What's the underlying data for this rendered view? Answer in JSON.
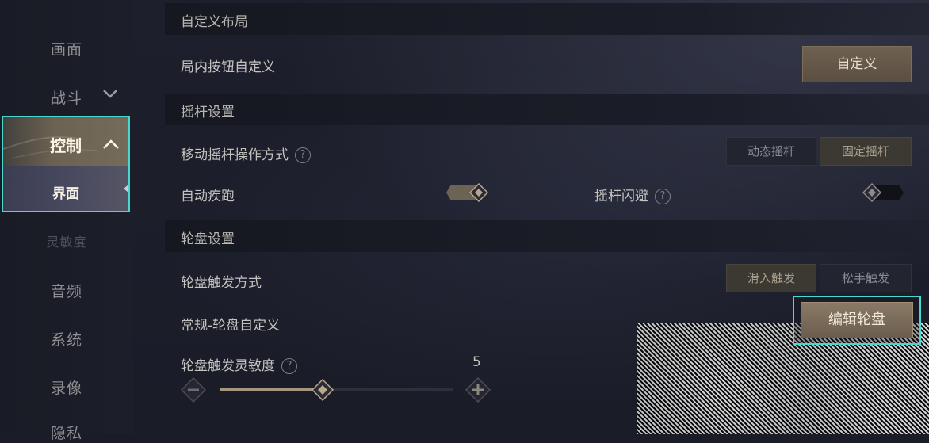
{
  "sidebar": {
    "items": [
      {
        "label": "画面"
      },
      {
        "label": "战斗"
      },
      {
        "label": "控制"
      },
      {
        "label": "界面"
      },
      {
        "label": "灵敏度"
      },
      {
        "label": "音频"
      },
      {
        "label": "系统"
      },
      {
        "label": "录像"
      },
      {
        "label": "隐私"
      }
    ]
  },
  "sections": {
    "custom_layout": {
      "title": "自定义布局",
      "in_game_buttons_label": "局内按钮自定义",
      "customize_button": "自定义"
    },
    "joystick": {
      "title": "摇杆设置",
      "mode_label": "移动摇杆操作方式",
      "mode_options": [
        "动态摇杆",
        "固定摇杆"
      ],
      "selected_mode": "固定摇杆",
      "auto_sprint_label": "自动疾跑",
      "auto_sprint_on": true,
      "dodge_label": "摇杆闪避",
      "dodge_on": false
    },
    "wheel": {
      "title": "轮盘设置",
      "trigger_label": "轮盘触发方式",
      "trigger_options": [
        "滑入触发",
        "松手触发"
      ],
      "selected_trigger": "滑入触发",
      "custom_label": "常规-轮盘自定义",
      "edit_button": "编辑轮盘",
      "sensitivity_label": "轮盘触发灵敏度",
      "sensitivity_value": "5",
      "sensitivity_fraction": 0.44
    }
  },
  "help_glyph": "?",
  "colors": {
    "highlight": "#48d8cf",
    "gold_button": "#6f6150"
  }
}
